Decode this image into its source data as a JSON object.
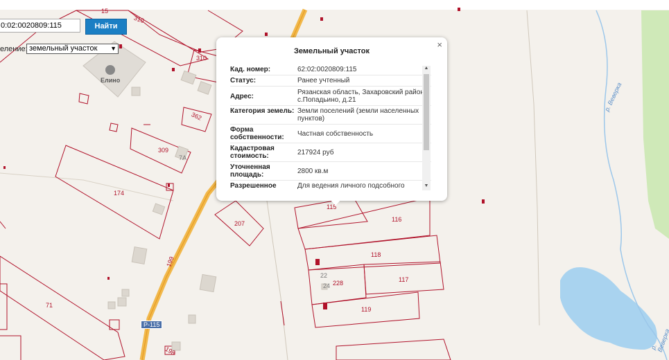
{
  "search": {
    "value": "0:02:0020809:115",
    "button": "Найти"
  },
  "selector": {
    "label": "еление:",
    "value": "земельный участок"
  },
  "popup": {
    "title": "Земельный участок",
    "close": "×",
    "rows": [
      {
        "key": "Кад. номер:",
        "value": "62:02:0020809:115"
      },
      {
        "key": "Статус:",
        "value": "Ранее учтенный"
      },
      {
        "key": "Адрес:",
        "value": "Рязанская область, Захаровский район, с.Попадьино, д.21"
      },
      {
        "key": "Категория земель:",
        "value": "Земли поселений (земли населенных пунктов)"
      },
      {
        "key": "Форма собственности:",
        "value": "Частная собственность"
      },
      {
        "key": "Кадастровая стоимость:",
        "value": "217924 руб"
      },
      {
        "key": "Уточненная площадь:",
        "value": "2800 кв.м"
      },
      {
        "key": "Разрешенное",
        "value": "Для ведения личного подсобного"
      }
    ]
  },
  "map": {
    "poi": "Елино",
    "road_shield": "Р-115",
    "river": "р. Веверка",
    "parcels": [
      "15",
      "310",
      "310",
      "362",
      "309",
      "7А",
      "174",
      "207",
      "199",
      "115",
      "116",
      "118",
      "22",
      "228",
      "24",
      "117",
      "119",
      "71",
      "198"
    ]
  },
  "colors": {
    "parcel": "#b0122a",
    "road": "#f1b84b",
    "water": "#a9d3ef",
    "forest": "#cfe9b8",
    "button": "#1b7fc4"
  }
}
